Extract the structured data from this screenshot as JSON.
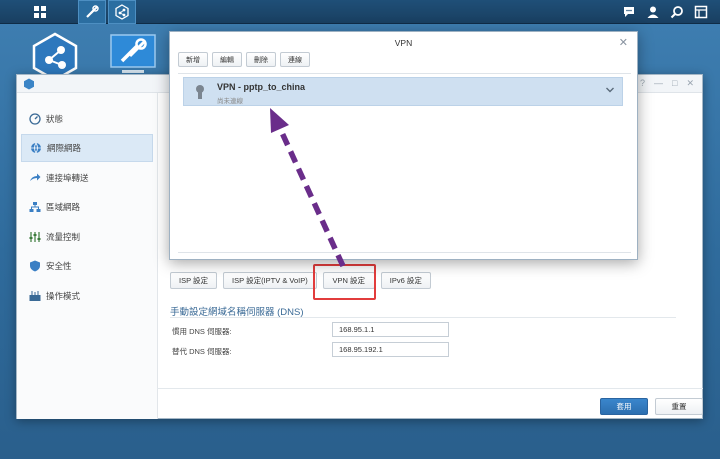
{
  "taskbar": {
    "right_icons": [
      "chat-icon",
      "user-icon",
      "search-icon",
      "widgets-icon"
    ]
  },
  "control_panel": {
    "sidebar": {
      "items": [
        {
          "label": "狀態",
          "icon": "speedometer-icon"
        },
        {
          "label": "網際網路",
          "icon": "globe-icon",
          "active": true
        },
        {
          "label": "連接埠轉送",
          "icon": "forward-arrow-icon"
        },
        {
          "label": "區域網路",
          "icon": "lan-icon"
        },
        {
          "label": "流量控制",
          "icon": "sliders-icon"
        },
        {
          "label": "安全性",
          "icon": "shield-icon"
        },
        {
          "label": "操作模式",
          "icon": "mode-icon"
        }
      ]
    },
    "tabs": [
      {
        "label": "ISP 設定"
      },
      {
        "label": "ISP 設定(IPTV & VoIP)"
      },
      {
        "label": "VPN 設定"
      },
      {
        "label": "IPv6 設定"
      }
    ],
    "dns_section": {
      "title": "手動設定網域名稱伺服器 (DNS)",
      "preferred_label": "慣用 DNS 伺服器:",
      "preferred_value": "168.95.1.1",
      "alternate_label": "替代 DNS 伺服器:",
      "alternate_value": "168.95.192.1"
    },
    "buttons": {
      "apply": "套用",
      "reset": "重置"
    }
  },
  "vpn_dialog": {
    "title": "VPN",
    "toolbar": [
      "新增",
      "編輯",
      "刪除",
      "連線"
    ],
    "profile": {
      "name": "VPN - pptp_to_china",
      "status": "尚未連線"
    }
  },
  "colors": {
    "highlight": "#e23c3c",
    "arrow": "#6a2d8a",
    "accent": "#2c6fb0"
  }
}
